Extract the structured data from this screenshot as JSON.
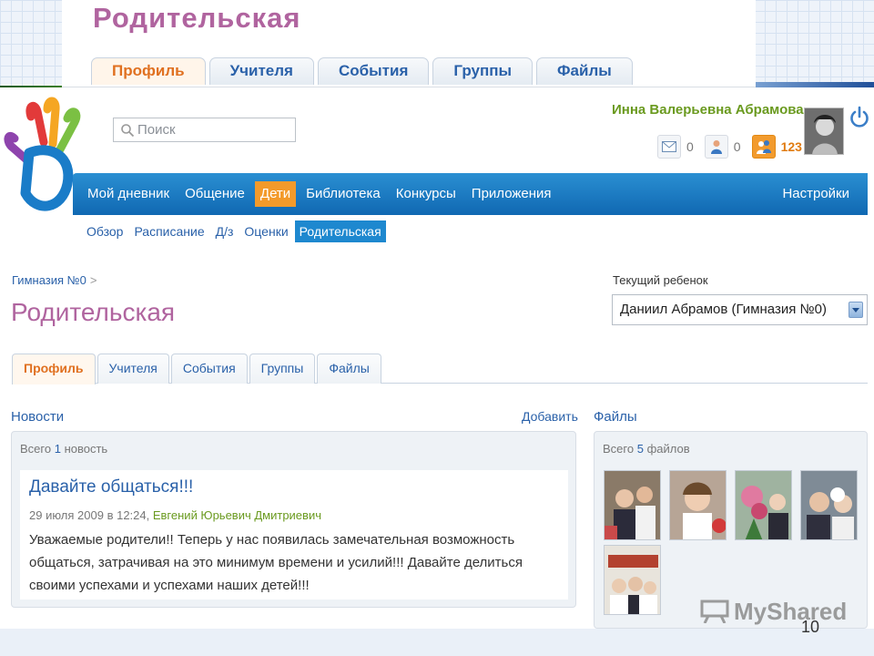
{
  "zoom_header": {
    "title": "Родительская",
    "tabs": [
      {
        "label": "Профиль",
        "active": true
      },
      {
        "label": "Учителя",
        "active": false
      },
      {
        "label": "События",
        "active": false
      },
      {
        "label": "Группы",
        "active": false
      },
      {
        "label": "Файлы",
        "active": false
      }
    ]
  },
  "header": {
    "search_placeholder": "Поиск",
    "user_name": "Инна Валерьевна Абрамова",
    "counters": [
      {
        "icon": "mail-icon",
        "value": "0"
      },
      {
        "icon": "person-icon",
        "value": "0"
      },
      {
        "icon": "friends-icon",
        "value": "123"
      }
    ]
  },
  "nav": {
    "items": [
      {
        "label": "Мой дневник",
        "active": false
      },
      {
        "label": "Общение",
        "active": false
      },
      {
        "label": "Дети",
        "active": true
      },
      {
        "label": "Библиотека",
        "active": false
      },
      {
        "label": "Конкурсы",
        "active": false
      },
      {
        "label": "Приложения",
        "active": false
      }
    ],
    "settings": "Настройки"
  },
  "subnav": {
    "items": [
      {
        "label": "Обзор",
        "active": false
      },
      {
        "label": "Расписание",
        "active": false
      },
      {
        "label": "Д/з",
        "active": false
      },
      {
        "label": "Оценки",
        "active": false
      },
      {
        "label": "Родительская",
        "active": true
      }
    ]
  },
  "page": {
    "breadcrumb": "Гимназия №0",
    "breadcrumb_sep": ">",
    "title": "Родительская",
    "child_label": "Текущий ребенок",
    "child_value": "Даниил Абрамов (Гимназия №0)"
  },
  "tabs": [
    {
      "label": "Профиль",
      "active": true
    },
    {
      "label": "Учителя",
      "active": false
    },
    {
      "label": "События",
      "active": false
    },
    {
      "label": "Группы",
      "active": false
    },
    {
      "label": "Файлы",
      "active": false
    }
  ],
  "news": {
    "heading": "Новости",
    "add_label": "Добавить",
    "count_prefix": "Всего",
    "count_number": "1",
    "count_suffix": "новость",
    "item": {
      "title": "Давайте общаться!!!",
      "date": "29 июля 2009 в 12:24,",
      "author": "Евгений Юрьевич Дмитриевич",
      "body": "Уважаемые родители!! Теперь у нас появилась замечательная возможность общаться, затрачивая на это минимум времени и усилий!!! Давайте делиться своими успехами и успехами наших детей!!!"
    }
  },
  "files": {
    "heading": "Файлы",
    "count_prefix": "Всего",
    "count_number": "5",
    "count_suffix": "файлов",
    "thumb_count": 5
  },
  "watermark": "MyShared",
  "slide_number": "10",
  "colors": {
    "accent_blue": "#1e88cf",
    "active_orange": "#f39a2a",
    "title_pink": "#b0649f",
    "link_blue": "#2a61a9",
    "user_green": "#6a9a1f"
  }
}
